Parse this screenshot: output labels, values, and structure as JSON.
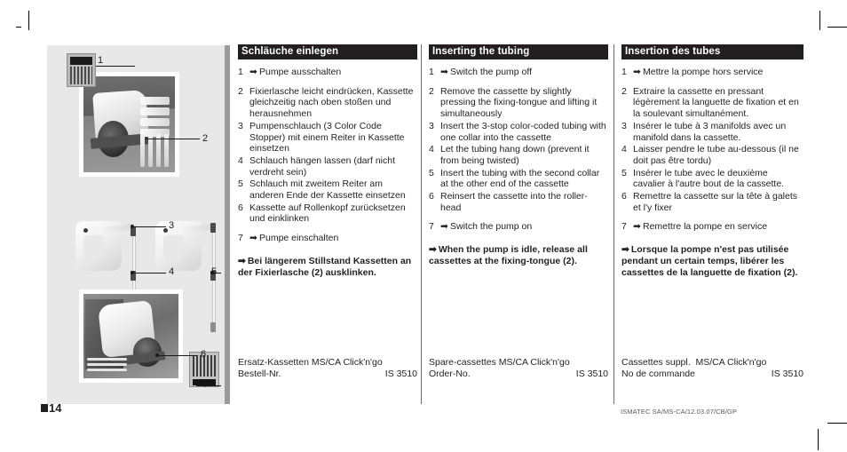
{
  "page": {
    "number": "14",
    "imprint": "ISMATEC SA/MS-CA/12.03.07/CB/GP"
  },
  "figure": {
    "name": "cassette-tubing-installation-figure",
    "callouts": [
      "1",
      "2",
      "3",
      "4",
      "5",
      "6",
      "7"
    ]
  },
  "columns": {
    "de": {
      "heading": "Schläuche einlegen",
      "steps": [
        {
          "num": "1",
          "arrow": "➡",
          "text": "Pumpe ausschalten"
        },
        {
          "num": "2",
          "arrow": "",
          "text": "Fixierlasche leicht eindrücken, Kassette gleichzeitig nach oben stoßen und herausnehmen"
        },
        {
          "num": "3",
          "arrow": "",
          "text": "Pumpenschlauch (3 Color Code Stopper) mit einem Reiter in Kassette einsetzen"
        },
        {
          "num": "4",
          "arrow": "",
          "text": "Schlauch hängen lassen (darf nicht verdreht sein)"
        },
        {
          "num": "5",
          "arrow": "",
          "text": "Schlauch mit zweitem Reiter am anderen Ende der Kassette einsetzen"
        },
        {
          "num": "6",
          "arrow": "",
          "text": "Kassette auf Rollenkopf zurücksetzen und einklinken"
        },
        {
          "num": "7",
          "arrow": "➡",
          "text": "Pumpe einschalten"
        }
      ],
      "note_arrow": "➡",
      "note": "Bei längerem Stillstand Kassetten an der Fixierlasche (2) ausklinken.",
      "order_title": "Ersatz-Kassetten MS/CA Click'n'go",
      "order_label": "Bestell-Nr.",
      "order_number": "IS 3510"
    },
    "en": {
      "heading": "Inserting the tubing",
      "steps": [
        {
          "num": "1",
          "arrow": "➡",
          "text": "Switch the pump off"
        },
        {
          "num": "2",
          "arrow": "",
          "text": "Remove the cassette by slightly pressing the fixing-tongue and lifting it simultaneously"
        },
        {
          "num": "3",
          "arrow": "",
          "text": "Insert the 3-stop color-coded tubing with one collar into the cassette"
        },
        {
          "num": "4",
          "arrow": "",
          "text": "Let the tubing hang down (prevent it from being twisted)"
        },
        {
          "num": "5",
          "arrow": "",
          "text": " Insert the tubing with the second collar at the other end of the cassette"
        },
        {
          "num": "6",
          "arrow": "",
          "text": "Reinsert the cassette into the roller-head"
        },
        {
          "num": "7",
          "arrow": "➡",
          "text": "Switch the pump on"
        }
      ],
      "note_arrow": "➡",
      "note": "When the pump is idle, release all cassettes at the fixing-tongue (2).",
      "order_title": "Spare-cassettes MS/CA Click'n'go",
      "order_label": "Order-No.",
      "order_number": "IS 3510"
    },
    "fr": {
      "heading": "Insertion des tubes",
      "steps": [
        {
          "num": "1",
          "arrow": "➡",
          "text": "Mettre la pompe hors service"
        },
        {
          "num": "2",
          "arrow": "",
          "text": "Extraire la cassette en pressant légèrement la languette de fixation et en la soulevant simultanément."
        },
        {
          "num": "3",
          "arrow": "",
          "text": "Insérer le tube à 3 manifolds avec un manifold dans la cassette."
        },
        {
          "num": "4",
          "arrow": "",
          "text": "Laisser pendre le tube au-dessous (il ne doit pas être tordu)"
        },
        {
          "num": "5",
          "arrow": "",
          "text": "Insérer le tube avec le deuxième cavalier à l'autre bout de la cassette."
        },
        {
          "num": "6",
          "arrow": "",
          "text": "Remettre la cassette sur la tête à galets et l'y fixer"
        },
        {
          "num": "7",
          "arrow": "➡",
          "text": "Remettre la pompe en service"
        }
      ],
      "note_arrow": "➡",
      "note": "Lorsque la pompe n'est pas utilisée pendant un certain temps, libérer les cassettes de la languette de fixation (2).",
      "order_title": "Cassettes suppl.  MS/CA Click'n'go",
      "order_label": "No de commande",
      "order_number": "IS 3510"
    }
  }
}
